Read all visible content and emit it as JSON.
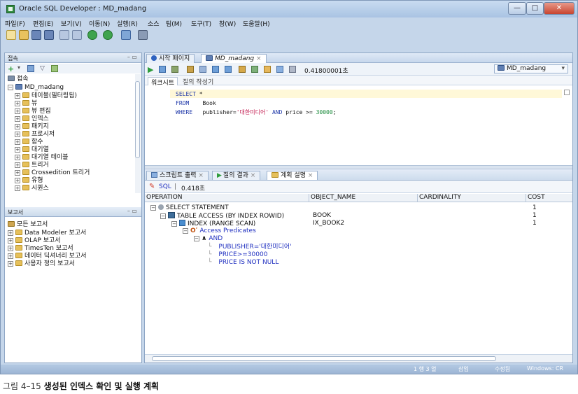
{
  "window": {
    "title": "Oracle SQL Developer : MD_madang"
  },
  "menu": [
    "파일(F)",
    "편집(E)",
    "보기(V)",
    "이동(N)",
    "실행(R)",
    "소스",
    "팀(M)",
    "도구(T)",
    "창(W)",
    "도움말(H)"
  ],
  "connections_pane": {
    "title": "접속",
    "tree": [
      {
        "label": "접속",
        "level": 0,
        "icon": "connections-icon"
      },
      {
        "label": "MD_madang",
        "level": 1,
        "icon": "database-icon"
      },
      {
        "label": "테이블(필터링됨)",
        "level": 2
      },
      {
        "label": "뷰",
        "level": 2
      },
      {
        "label": "뷰 편집",
        "level": 2
      },
      {
        "label": "인덱스",
        "level": 2
      },
      {
        "label": "패키지",
        "level": 2
      },
      {
        "label": "프로시저",
        "level": 2
      },
      {
        "label": "함수",
        "level": 2
      },
      {
        "label": "대기열",
        "level": 2
      },
      {
        "label": "대기열 테이블",
        "level": 2
      },
      {
        "label": "트리거",
        "level": 2
      },
      {
        "label": "Crossedition 트리거",
        "level": 2
      },
      {
        "label": "유형",
        "level": 2
      },
      {
        "label": "시퀀스",
        "level": 2
      }
    ]
  },
  "reports_pane": {
    "title": "보고서",
    "tree": [
      {
        "label": "모든 보고서",
        "level": 0
      },
      {
        "label": "Data Modeler 보고서",
        "level": 1
      },
      {
        "label": "OLAP 보고서",
        "level": 1
      },
      {
        "label": "TimesTen 보고서",
        "level": 1
      },
      {
        "label": "데이터 딕셔너리 보고서",
        "level": 1
      },
      {
        "label": "사용자 정의 보고서",
        "level": 1
      }
    ]
  },
  "editor": {
    "tabs": [
      "시작 페이지",
      "MD_madang"
    ],
    "elapsed": "0.41800001초",
    "connection": "MD_madang",
    "sheet_tabs": [
      "워크시트",
      "질의 작성기"
    ],
    "code": {
      "line1": {
        "kw": "SELECT",
        "rest": " *"
      },
      "line2": {
        "kw": "FROM",
        "rest": "    Book"
      },
      "line3": {
        "kw": "WHERE",
        "pre": "   publisher=",
        "str": "'대한미디어'",
        "and": " AND ",
        "mid": "price >= ",
        "num": "30000",
        "end": ";"
      }
    }
  },
  "output": {
    "tabs": [
      "스크립트 출력",
      "질의 결과",
      "계획 설명"
    ],
    "sql_label": "SQL",
    "elapsed": "0.418초",
    "columns": [
      "OPERATION",
      "OBJECT_NAME",
      "CARDINALITY",
      "COST"
    ],
    "rows": [
      {
        "op": "SELECT STATEMENT",
        "object": "",
        "cardinality": "",
        "cost": "1"
      },
      {
        "op": "TABLE ACCESS (BY INDEX ROWID)",
        "object": "BOOK",
        "cardinality": "",
        "cost": "1"
      },
      {
        "op": "INDEX (RANGE SCAN)",
        "object": "IX_BOOK2",
        "cardinality": "",
        "cost": "1"
      },
      {
        "op": "Access Predicates",
        "object": "",
        "cardinality": "",
        "cost": ""
      },
      {
        "op": "AND",
        "object": "",
        "cardinality": "",
        "cost": ""
      },
      {
        "op": "PUBLISHER='대한미디어'",
        "object": "",
        "cardinality": "",
        "cost": ""
      },
      {
        "op": "PRICE>=30000",
        "object": "",
        "cardinality": "",
        "cost": ""
      },
      {
        "op": "PRICE IS NOT NULL",
        "object": "",
        "cardinality": "",
        "cost": ""
      }
    ]
  },
  "statusbar": {
    "position": "1 행 3 열",
    "mode": "삽입",
    "state": "수정됨",
    "eol": "Windows: CR"
  },
  "caption": {
    "prefix": "그림 4–15",
    "bold": "생성된 인덱스 확인 및 실행 계획"
  }
}
